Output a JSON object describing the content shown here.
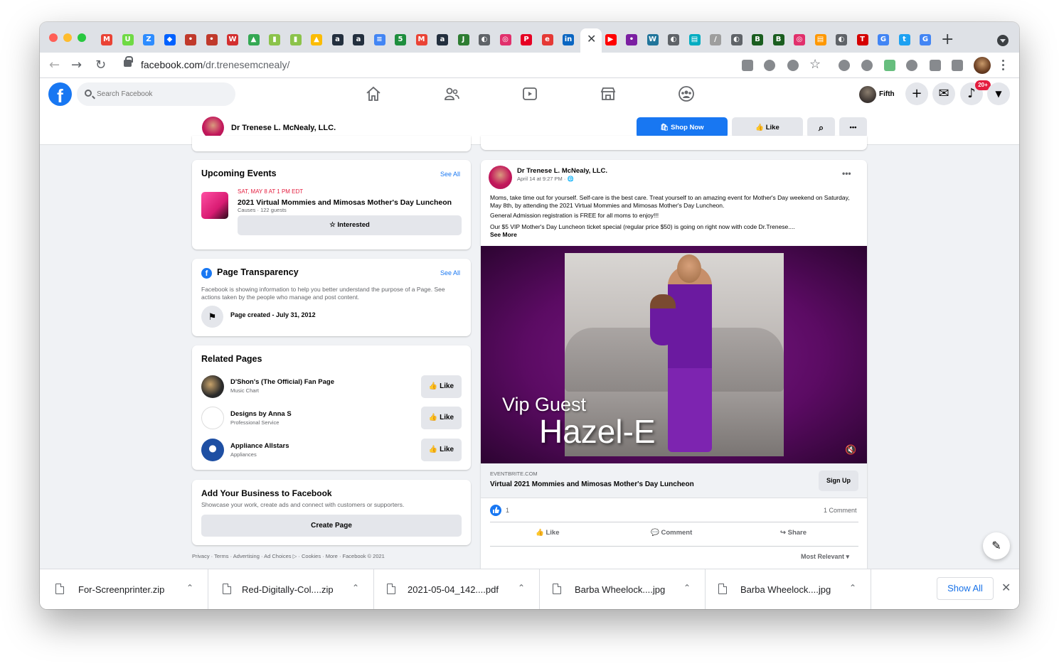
{
  "browser": {
    "url_domain": "facebook.com",
    "url_path": "/dr.trenesemcnealy/",
    "tab_close_glyph": "✕",
    "tab_icons": [
      {
        "name": "gmail-icon",
        "color": "#ea4335",
        "glyph": "M"
      },
      {
        "name": "upwork-icon",
        "color": "#6fda44",
        "glyph": "U"
      },
      {
        "name": "zoom-icon",
        "color": "#2d8cff",
        "glyph": "Z"
      },
      {
        "name": "dropbox-icon",
        "color": "#0061ff",
        "glyph": "◆"
      },
      {
        "name": "tab-icon-5",
        "color": "#c0392b",
        "glyph": "•"
      },
      {
        "name": "tab-icon-6",
        "color": "#c0392b",
        "glyph": "•"
      },
      {
        "name": "tab-icon-7",
        "color": "#d32f2f",
        "glyph": "W"
      },
      {
        "name": "google-drive-icon",
        "color": "#34a853",
        "glyph": "▲"
      },
      {
        "name": "shopping-icon",
        "color": "#8bc34a",
        "glyph": "▮"
      },
      {
        "name": "shopping-icon-2",
        "color": "#8bc34a",
        "glyph": "▮"
      },
      {
        "name": "google-drive-icon-2",
        "color": "#fbbc04",
        "glyph": "▲"
      },
      {
        "name": "amazon-icon",
        "color": "#232f3e",
        "glyph": "a"
      },
      {
        "name": "amazon-icon-2",
        "color": "#232f3e",
        "glyph": "a"
      },
      {
        "name": "google-docs-icon",
        "color": "#4285f4",
        "glyph": "≡"
      },
      {
        "name": "calendar-icon",
        "color": "#1e8e3e",
        "glyph": "5"
      },
      {
        "name": "gmail-icon-2",
        "color": "#ea4335",
        "glyph": "M"
      },
      {
        "name": "amazon-icon-3",
        "color": "#232f3e",
        "glyph": "a"
      },
      {
        "name": "tab-icon-18",
        "color": "#2e7d32",
        "glyph": "J"
      },
      {
        "name": "globe-icon",
        "color": "#5f6368",
        "glyph": "◐"
      },
      {
        "name": "instagram-icon",
        "color": "#e1306c",
        "glyph": "◎"
      },
      {
        "name": "pinterest-icon",
        "color": "#e60023",
        "glyph": "P"
      },
      {
        "name": "tab-icon-22",
        "color": "#e53935",
        "glyph": "e"
      },
      {
        "name": "linkedin-icon",
        "color": "#0a66c2",
        "glyph": "in"
      },
      {
        "name": "youtube-icon",
        "color": "#ff0000",
        "glyph": "▶"
      },
      {
        "name": "tab-icon-26",
        "color": "#7b1fa2",
        "glyph": "•"
      },
      {
        "name": "wordpress-icon",
        "color": "#21759b",
        "glyph": "W"
      },
      {
        "name": "globe-icon-2",
        "color": "#5f6368",
        "glyph": "◐"
      },
      {
        "name": "tab-icon-29",
        "color": "#00acc1",
        "glyph": "▤"
      },
      {
        "name": "tab-icon-30",
        "color": "#9e9e9e",
        "glyph": "/"
      },
      {
        "name": "globe-icon-3",
        "color": "#5f6368",
        "glyph": "◐"
      },
      {
        "name": "bdn-icon",
        "color": "#1b5e20",
        "glyph": "B"
      },
      {
        "name": "bdn-icon-2",
        "color": "#1b5e20",
        "glyph": "B"
      },
      {
        "name": "instagram-icon-2",
        "color": "#e1306c",
        "glyph": "◎"
      },
      {
        "name": "tab-icon-35",
        "color": "#ff9800",
        "glyph": "▤"
      },
      {
        "name": "globe-icon-4",
        "color": "#5f6368",
        "glyph": "◐"
      },
      {
        "name": "tab-icon-37",
        "color": "#d50000",
        "glyph": "T"
      },
      {
        "name": "google-icon",
        "color": "#4285f4",
        "glyph": "G"
      },
      {
        "name": "twitter-icon",
        "color": "#1da1f2",
        "glyph": "t"
      },
      {
        "name": "google-icon-2",
        "color": "#4285f4",
        "glyph": "G"
      }
    ]
  },
  "fb": {
    "search_placeholder": "Search Facebook",
    "account_name": "Fifth",
    "notifications_badge": "20+"
  },
  "page_bar": {
    "name": "Dr Trenese L. McNealy, LLC.",
    "shop_now": "Shop Now",
    "like": "Like"
  },
  "upcoming_events": {
    "title": "Upcoming Events",
    "see_all": "See All",
    "date": "SAT, MAY 8 AT 1 PM EDT",
    "event_title": "2021 Virtual Mommies and Mimosas Mother's Day Luncheon",
    "event_sub": "Causes · 122 guests",
    "interested": "Interested"
  },
  "transparency": {
    "title": "Page Transparency",
    "see_all": "See All",
    "description": "Facebook is showing information to help you better understand the purpose of a Page. See actions taken by the people who manage and post content.",
    "created": "Page created - July 31, 2012"
  },
  "related": {
    "title": "Related Pages",
    "like": "Like",
    "items": [
      {
        "name": "D'Shon's (The Official) Fan Page",
        "category": "Music Chart"
      },
      {
        "name": "Designs by Anna S",
        "category": "Professional Service"
      },
      {
        "name": "Appliance Allstars",
        "category": "Appliances"
      }
    ]
  },
  "business": {
    "title": "Add Your Business to Facebook",
    "description": "Showcase your work, create ads and connect with customers or supporters.",
    "button": "Create Page"
  },
  "footer": "Privacy · Terms · Advertising · Ad Choices ▷ · Cookies · More · Facebook © 2021",
  "post": {
    "author": "Dr Trenese L. McNealy, LLC.",
    "time": "April 14 at 9:27 PM · ",
    "text1": "Moms, take time out for yourself. Self-care is the best care. Treat yourself to an amazing event for Mother's Day weekend on Saturday, May 8th, by attending the 2021 Virtual Mommies and Mimosas Mother's Day Luncheon.",
    "text2": "General Admission registration is FREE for all moms to enjoy!!!",
    "text3": "Our $5 VIP Mother's Day Luncheon ticket special (regular price $50) is going on right now with code Dr.Trenese....",
    "see_more": "See More",
    "overlay_line1": "Vip Guest",
    "overlay_line2": "Hazel-E",
    "link_domain": "EVENTBRITE.COM",
    "link_title": "Virtual 2021 Mommies and Mimosas Mother's Day Luncheon",
    "sign_up": "Sign Up",
    "like_count": "1",
    "comment_count": "1 Comment",
    "like": "Like",
    "comment": "Comment",
    "share": "Share",
    "sort": "Most Relevant"
  },
  "downloads": {
    "items": [
      "For-Screenprinter.zip",
      "Red-Digitally-Col....zip",
      "2021-05-04_142....pdf",
      "Barba Wheelock....jpg",
      "Barba Wheelock....jpg"
    ],
    "show_all": "Show All"
  }
}
